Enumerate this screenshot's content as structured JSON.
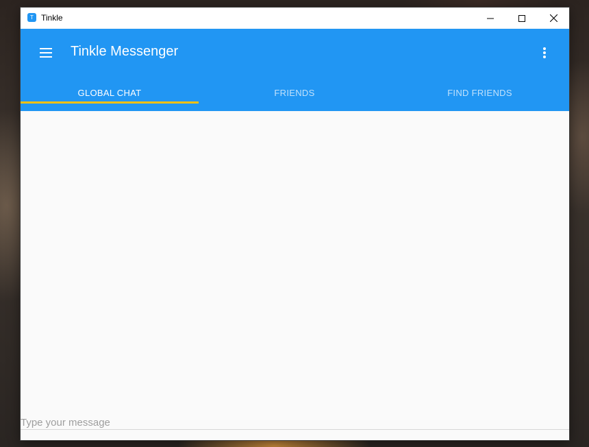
{
  "window": {
    "title": "Tinkle",
    "icon_glyph": "T",
    "controls": [
      "minimize",
      "maximize",
      "close"
    ]
  },
  "appbar": {
    "title": "Tinkle Messenger",
    "menu_icon": "hamburger-menu-icon",
    "overflow_icon": "more-vert-icon",
    "color": "#2196f3"
  },
  "tabs": [
    {
      "label": "GLOBAL CHAT",
      "active": true
    },
    {
      "label": "FRIENDS",
      "active": false
    },
    {
      "label": "FIND FRIENDS",
      "active": false
    }
  ],
  "indicator_color": "#ffc107",
  "composer": {
    "placeholder": "Type your message",
    "value": ""
  }
}
